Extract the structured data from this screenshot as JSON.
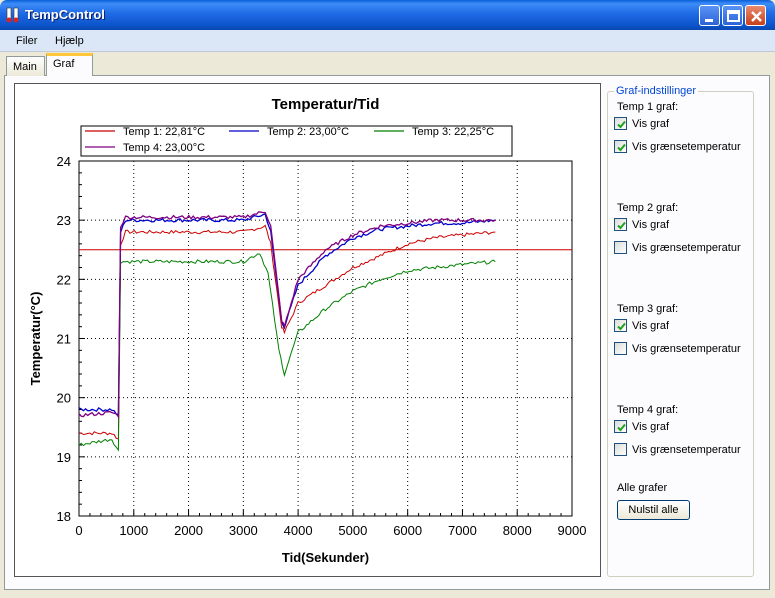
{
  "window": {
    "title": "TempControl"
  },
  "menu": [
    "Filer",
    "Hjælp"
  ],
  "tabs": [
    "Main",
    "Graf"
  ],
  "chart_data": {
    "type": "line",
    "title": "Temperatur/Tid",
    "xlabel": "Tid(Sekunder)",
    "ylabel": "Temperatur(°C)",
    "xlim": [
      0,
      9000
    ],
    "ylim": [
      18,
      24
    ],
    "xticks": [
      0,
      1000,
      2000,
      3000,
      4000,
      5000,
      6000,
      7000,
      8000,
      9000
    ],
    "yticks": [
      18,
      19,
      20,
      21,
      22,
      23,
      24
    ],
    "grid": true,
    "legend_position": "top",
    "threshold": {
      "value": 22.5,
      "color": "#cc0000"
    },
    "series": [
      {
        "name": "Temp 1: 22,81°C",
        "color": "#cc0000",
        "points": [
          [
            0,
            19.4
          ],
          [
            600,
            19.4
          ],
          [
            720,
            19.3
          ],
          [
            760,
            22.6
          ],
          [
            850,
            22.8
          ],
          [
            3000,
            22.8
          ],
          [
            3400,
            22.9
          ],
          [
            3500,
            22.6
          ],
          [
            3700,
            21.2
          ],
          [
            3750,
            21.1
          ],
          [
            4000,
            21.6
          ],
          [
            4500,
            21.9
          ],
          [
            5000,
            22.2
          ],
          [
            5500,
            22.4
          ],
          [
            6000,
            22.6
          ],
          [
            6500,
            22.7
          ],
          [
            7000,
            22.75
          ],
          [
            7600,
            22.8
          ]
        ]
      },
      {
        "name": "Temp 2: 23,00°C",
        "color": "#0000cc",
        "points": [
          [
            0,
            19.8
          ],
          [
            600,
            19.8
          ],
          [
            720,
            19.7
          ],
          [
            760,
            22.8
          ],
          [
            850,
            23.0
          ],
          [
            3000,
            23.0
          ],
          [
            3400,
            23.1
          ],
          [
            3500,
            22.8
          ],
          [
            3700,
            21.3
          ],
          [
            3750,
            21.2
          ],
          [
            4000,
            21.9
          ],
          [
            4500,
            22.4
          ],
          [
            5000,
            22.7
          ],
          [
            5500,
            22.85
          ],
          [
            6000,
            22.9
          ],
          [
            6500,
            22.95
          ],
          [
            7000,
            22.95
          ],
          [
            7600,
            23.0
          ]
        ]
      },
      {
        "name": "Temp 3: 22,25°C",
        "color": "#008000",
        "points": [
          [
            0,
            19.2
          ],
          [
            600,
            19.3
          ],
          [
            720,
            19.1
          ],
          [
            760,
            22.3
          ],
          [
            850,
            22.3
          ],
          [
            3000,
            22.3
          ],
          [
            3300,
            22.45
          ],
          [
            3450,
            22.1
          ],
          [
            3650,
            20.8
          ],
          [
            3750,
            20.4
          ],
          [
            4000,
            21.1
          ],
          [
            4500,
            21.5
          ],
          [
            5000,
            21.8
          ],
          [
            5500,
            22.0
          ],
          [
            6000,
            22.15
          ],
          [
            6500,
            22.2
          ],
          [
            7000,
            22.25
          ],
          [
            7600,
            22.3
          ]
        ]
      },
      {
        "name": "Temp 4: 23,00°C",
        "color": "#800080",
        "points": [
          [
            0,
            19.7
          ],
          [
            600,
            19.75
          ],
          [
            720,
            19.7
          ],
          [
            760,
            22.9
          ],
          [
            850,
            23.05
          ],
          [
            3000,
            23.05
          ],
          [
            3400,
            23.15
          ],
          [
            3500,
            22.9
          ],
          [
            3700,
            21.3
          ],
          [
            3750,
            21.2
          ],
          [
            4000,
            22.0
          ],
          [
            4500,
            22.5
          ],
          [
            5000,
            22.75
          ],
          [
            5500,
            22.9
          ],
          [
            6000,
            22.95
          ],
          [
            6500,
            23.0
          ],
          [
            7000,
            23.0
          ],
          [
            7600,
            23.0
          ]
        ]
      }
    ]
  },
  "settings": {
    "title": "Graf-indstillinger",
    "groups": [
      {
        "label": "Temp 1 graf:",
        "show_graph": {
          "label": "Vis graf",
          "checked": true
        },
        "show_limit": {
          "label": "Vis grænsetemperatur",
          "checked": true
        }
      },
      {
        "label": "Temp 2 graf:",
        "show_graph": {
          "label": "Vis graf",
          "checked": true
        },
        "show_limit": {
          "label": "Vis grænsetemperatur",
          "checked": false
        }
      },
      {
        "label": "Temp 3 graf:",
        "show_graph": {
          "label": "Vis graf",
          "checked": true
        },
        "show_limit": {
          "label": "Vis grænsetemperatur",
          "checked": false
        }
      },
      {
        "label": "Temp 4 graf:",
        "show_graph": {
          "label": "Vis graf",
          "checked": true
        },
        "show_limit": {
          "label": "Vis grænsetemperatur",
          "checked": false
        }
      }
    ],
    "all_label": "Alle grafer",
    "reset_label": "Nulstil alle"
  }
}
